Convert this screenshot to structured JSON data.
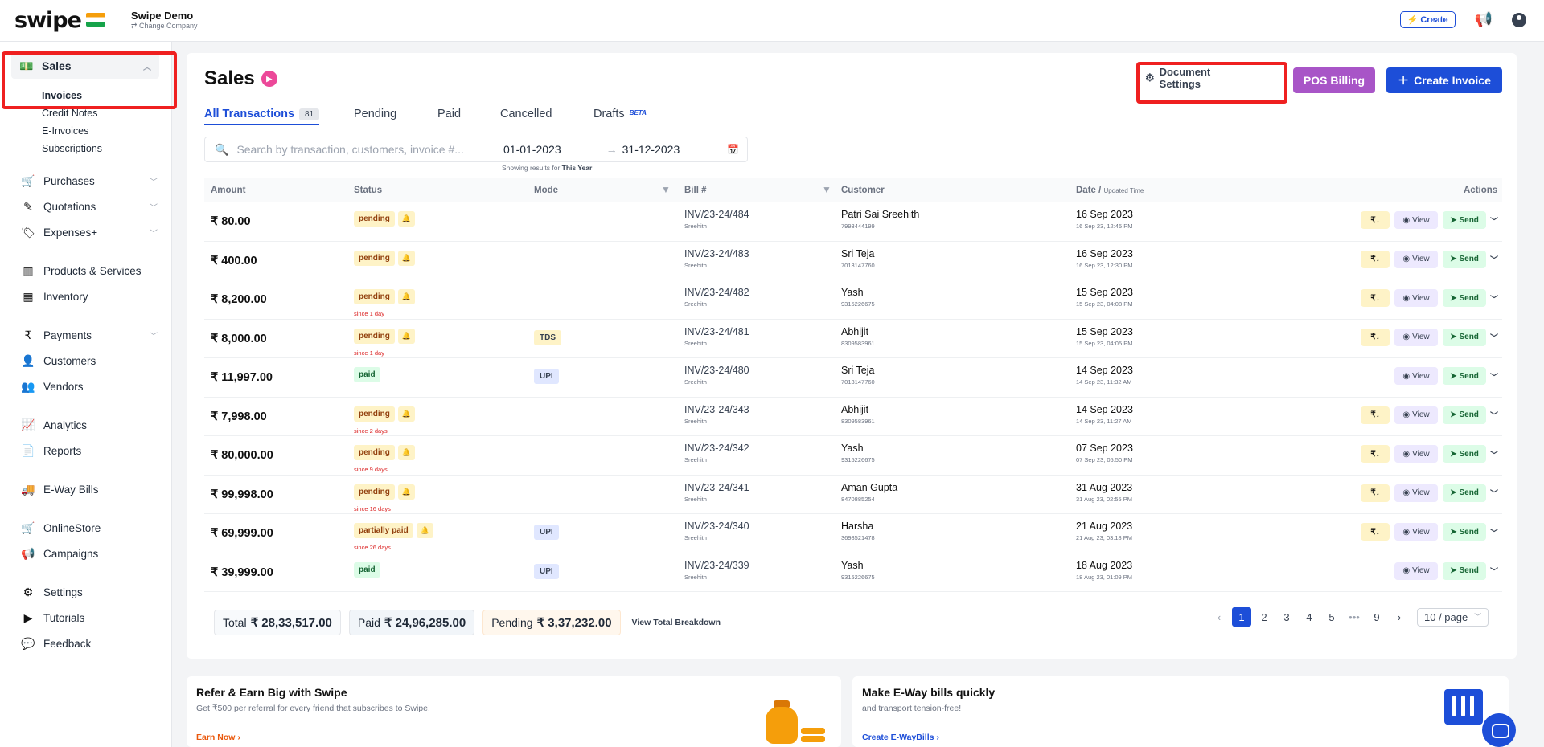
{
  "brand": {
    "logo": "swipe",
    "company_name": "Swipe Demo",
    "change_company": "Change Company"
  },
  "topbar": {
    "create_label": "⚡ Create"
  },
  "sidebar": {
    "sales": "Sales",
    "sales_sub": [
      "Invoices",
      "Credit Notes",
      "E-Invoices",
      "Subscriptions"
    ],
    "items": [
      {
        "label": "Purchases",
        "icon": "cart-icon"
      },
      {
        "label": "Quotations",
        "icon": "pen-icon"
      },
      {
        "label": "Expenses+",
        "icon": "tag-icon"
      },
      {
        "label": "Products & Services",
        "icon": "barcode-icon"
      },
      {
        "label": "Inventory",
        "icon": "warehouse-icon"
      },
      {
        "label": "Payments",
        "icon": "rupee-icon"
      },
      {
        "label": "Customers",
        "icon": "user-icon"
      },
      {
        "label": "Vendors",
        "icon": "users-icon"
      },
      {
        "label": "Analytics",
        "icon": "chart-icon"
      },
      {
        "label": "Reports",
        "icon": "report-icon"
      },
      {
        "label": "E-Way Bills",
        "icon": "truck-icon"
      },
      {
        "label": "OnlineStore",
        "icon": "store-icon"
      },
      {
        "label": "Campaigns",
        "icon": "megaphone-icon"
      },
      {
        "label": "Settings",
        "icon": "gear-icon"
      },
      {
        "label": "Tutorials",
        "icon": "youtube-icon"
      },
      {
        "label": "Feedback",
        "icon": "comment-icon"
      }
    ]
  },
  "page": {
    "title": "Sales",
    "document_settings": "Document Settings",
    "pos_billing": "POS Billing",
    "create_invoice": "Create Invoice"
  },
  "tabs": {
    "all": "All Transactions",
    "all_count": "81",
    "pending": "Pending",
    "paid": "Paid",
    "cancelled": "Cancelled",
    "drafts": "Drafts",
    "beta": "BETA"
  },
  "search": {
    "placeholder": "Search by transaction, customers, invoice #...",
    "date_from": "01-01-2023",
    "date_to": "31-12-2023",
    "showing_prefix": "Showing results for",
    "showing_period": "This Year"
  },
  "table": {
    "headers": {
      "amount": "Amount",
      "status": "Status",
      "mode": "Mode",
      "bill": "Bill #",
      "customer": "Customer",
      "date": "Date /",
      "date_sub": "Updated Time",
      "actions": "Actions"
    },
    "action_labels": {
      "pay": "₹↓",
      "view": "View",
      "send": "Send"
    },
    "rows": [
      {
        "amount": "₹ 80.00",
        "status": "pending",
        "since": "",
        "mode": "",
        "bill": "INV/23-24/484",
        "bill_by": "Sreehith",
        "customer": "Patri Sai Sreehith",
        "phone": "7993444199",
        "date": "16 Sep 2023",
        "updated": "16 Sep 23, 12:45 PM",
        "pay": true
      },
      {
        "amount": "₹ 400.00",
        "status": "pending",
        "since": "",
        "mode": "",
        "bill": "INV/23-24/483",
        "bill_by": "Sreehith",
        "customer": "Sri Teja",
        "phone": "7013147760",
        "date": "16 Sep 2023",
        "updated": "16 Sep 23, 12:30 PM",
        "pay": true
      },
      {
        "amount": "₹ 8,200.00",
        "status": "pending",
        "since": "since 1 day",
        "mode": "",
        "bill": "INV/23-24/482",
        "bill_by": "Sreehith",
        "customer": "Yash",
        "phone": "9315226675",
        "date": "15 Sep 2023",
        "updated": "15 Sep 23, 04:08 PM",
        "pay": true
      },
      {
        "amount": "₹ 8,000.00",
        "status": "pending",
        "since": "since 1 day",
        "mode": "TDS",
        "bill": "INV/23-24/481",
        "bill_by": "Sreehith",
        "customer": "Abhijit",
        "phone": "8309583961",
        "date": "15 Sep 2023",
        "updated": "15 Sep 23, 04:05 PM",
        "pay": true
      },
      {
        "amount": "₹ 11,997.00",
        "status": "paid",
        "since": "",
        "mode": "UPI",
        "bill": "INV/23-24/480",
        "bill_by": "Sreehith",
        "customer": "Sri Teja",
        "phone": "7013147760",
        "date": "14 Sep 2023",
        "updated": "14 Sep 23, 11:32 AM",
        "pay": false
      },
      {
        "amount": "₹ 7,998.00",
        "status": "pending",
        "since": "since 2 days",
        "mode": "",
        "bill": "INV/23-24/343",
        "bill_by": "Sreehith",
        "customer": "Abhijit",
        "phone": "8309583961",
        "date": "14 Sep 2023",
        "updated": "14 Sep 23, 11:27 AM",
        "pay": true
      },
      {
        "amount": "₹ 80,000.00",
        "status": "pending",
        "since": "since 9 days",
        "mode": "",
        "bill": "INV/23-24/342",
        "bill_by": "Sreehith",
        "customer": "Yash",
        "phone": "9315226675",
        "date": "07 Sep 2023",
        "updated": "07 Sep 23, 05:50 PM",
        "pay": true
      },
      {
        "amount": "₹ 99,998.00",
        "status": "pending",
        "since": "since 16 days",
        "mode": "",
        "bill": "INV/23-24/341",
        "bill_by": "Sreehith",
        "customer": "Aman Gupta",
        "phone": "8470885254",
        "date": "31 Aug 2023",
        "updated": "31 Aug 23, 02:55 PM",
        "pay": true
      },
      {
        "amount": "₹ 69,999.00",
        "status": "partially paid",
        "since": "since 26 days",
        "mode": "UPI",
        "bill": "INV/23-24/340",
        "bill_by": "Sreehith",
        "customer": "Harsha",
        "phone": "3698521478",
        "date": "21 Aug 2023",
        "updated": "21 Aug 23, 03:18 PM",
        "pay": true
      },
      {
        "amount": "₹ 39,999.00",
        "status": "paid",
        "since": "",
        "mode": "UPI",
        "bill": "INV/23-24/339",
        "bill_by": "Sreehith",
        "customer": "Yash",
        "phone": "9315226675",
        "date": "18 Aug 2023",
        "updated": "18 Aug 23, 01:09 PM",
        "pay": false
      }
    ]
  },
  "totals": {
    "total_label": "Total",
    "total_value": "₹ 28,33,517.00",
    "paid_label": "Paid",
    "paid_value": "₹ 24,96,285.00",
    "pending_label": "Pending",
    "pending_value": "₹ 3,37,232.00",
    "breakdown": "View Total Breakdown"
  },
  "pagination": {
    "pages": [
      "1",
      "2",
      "3",
      "4",
      "5"
    ],
    "ellipsis": "•••",
    "last": "9",
    "per_page": "10 / page"
  },
  "promos": [
    {
      "title": "Refer & Earn Big with Swipe",
      "desc": "Get ₹500 per referral for every friend that subscribes to Swipe!",
      "link": "Earn Now ›",
      "link_color": "#ea580c"
    },
    {
      "title": "Make E-Way bills quickly",
      "desc": "and transport tension-free!",
      "link": "Create E-WayBills ›",
      "link_color": "#1d4ed8"
    }
  ],
  "colors": {
    "accent": "#1d4ed8",
    "pos": "#a855c7",
    "highlight_box": "#ef2020"
  }
}
